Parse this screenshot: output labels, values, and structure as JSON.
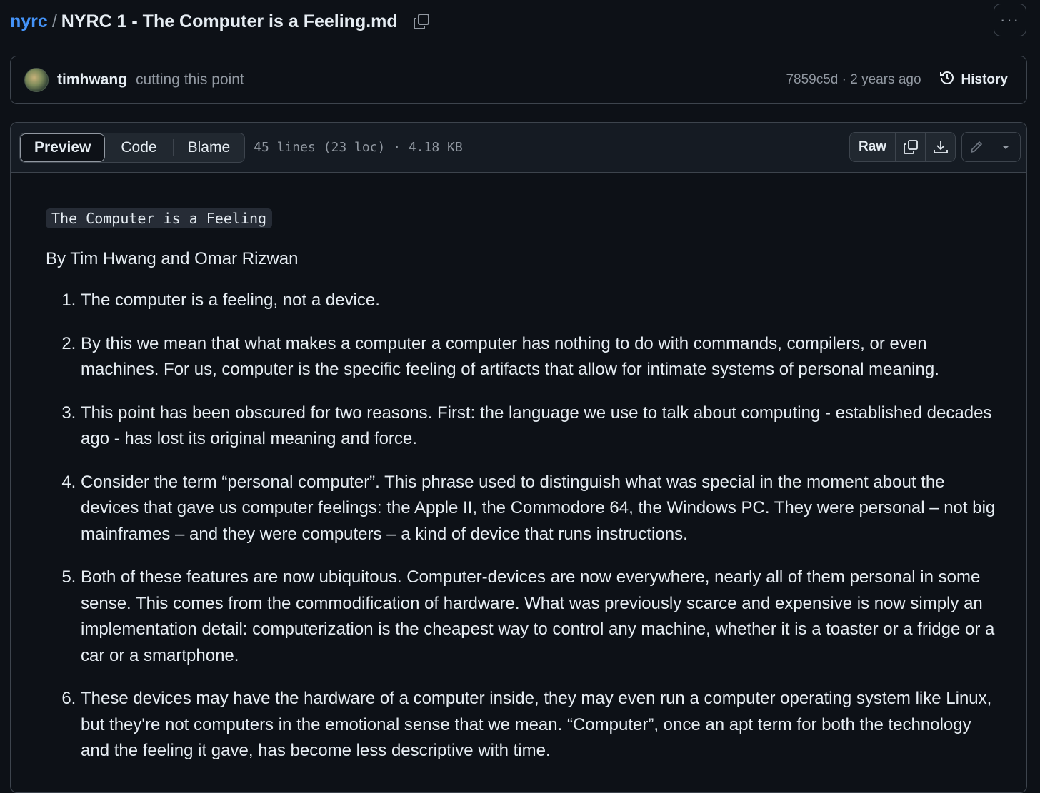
{
  "breadcrumb": {
    "repo": "nyrc",
    "separator": "/",
    "file": "NYRC 1 - The Computer is a Feeling.md"
  },
  "more_menu_label": "···",
  "commit": {
    "author": "timhwang",
    "message": "cutting this point",
    "sha_time": "7859c5d · 2 years ago",
    "history_label": "History"
  },
  "file_toolbar": {
    "tabs": [
      "Preview",
      "Code",
      "Blame"
    ],
    "meta": "45 lines (23 loc) · 4.18 KB",
    "raw_label": "Raw"
  },
  "document": {
    "code_title": "The Computer is a Feeling",
    "byline": "By Tim Hwang and Omar Rizwan",
    "items": [
      "The computer is a feeling, not a device.",
      "By this we mean that what makes a computer a computer has nothing to do with commands, compilers, or even machines. For us, computer is the specific feeling of artifacts that allow for intimate systems of personal meaning.",
      "This point has been obscured for two reasons. First: the language we use to talk about computing - established decades ago - has lost its original meaning and force.",
      "Consider the term “personal computer”. This phrase used to distinguish what was special in the moment about the devices that gave us computer feelings: the Apple II, the Commodore 64, the Windows PC. They were personal – not big mainframes – and they were computers – a kind of device that runs instructions.",
      "Both of these features are now ubiquitous. Computer-devices are now everywhere, nearly all of them personal in some sense. This comes from the commodification of hardware. What was previously scarce and expensive is now simply an implementation detail: computerization is the cheapest way to control any machine, whether it is a toaster or a fridge or a car or a smartphone.",
      "These devices may have the hardware of a computer inside, they may even run a computer operating system like Linux, but they're not computers in the emotional sense that we mean. “Computer”, once an apt term for both the technology and the feeling it gave, has become less descriptive with time."
    ]
  },
  "colors": {
    "background": "#0d1117",
    "link": "#4493f8",
    "muted": "#9198a1",
    "border": "#3d444d"
  }
}
